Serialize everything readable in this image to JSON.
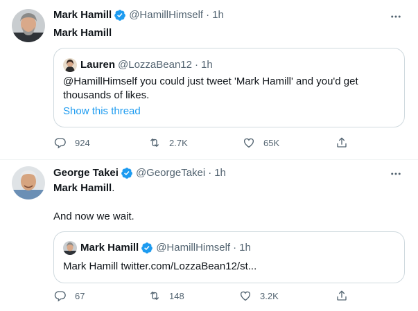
{
  "tweets": [
    {
      "name": "Mark Hamill",
      "handle": "@HamillHimself",
      "separator": "·",
      "time": "1h",
      "text": "Mark Hamill",
      "quote": {
        "name": "Lauren",
        "handle": "@LozzaBean12",
        "separator": "·",
        "time": "1h",
        "text": "@HamillHimself you could just tweet 'Mark Hamill' and you'd get thousands of likes.",
        "show_thread": "Show this thread"
      },
      "replies": "924",
      "retweets": "2.7K",
      "likes": "65K"
    },
    {
      "name": "George Takei",
      "handle": "@GeorgeTakei",
      "separator": "·",
      "time": "1h",
      "text_bold": "Mark Hamill",
      "text_after": ".",
      "text_line2": "And now we wait.",
      "quote": {
        "name": "Mark Hamill",
        "handle": "@HamillHimself",
        "separator": "·",
        "time": "1h",
        "text": "Mark Hamill twitter.com/LozzaBean12/st..."
      },
      "replies": "67",
      "retweets": "148",
      "likes": "3.2K"
    }
  ],
  "colors": {
    "text": "#0f1419",
    "secondary": "#536471",
    "link": "#1d9bf0",
    "verified": "#1d9bf0",
    "border": "#cfd9de"
  },
  "icons": [
    "verified-badge-icon",
    "more-icon",
    "reply-icon",
    "retweet-icon",
    "like-icon",
    "share-icon"
  ]
}
